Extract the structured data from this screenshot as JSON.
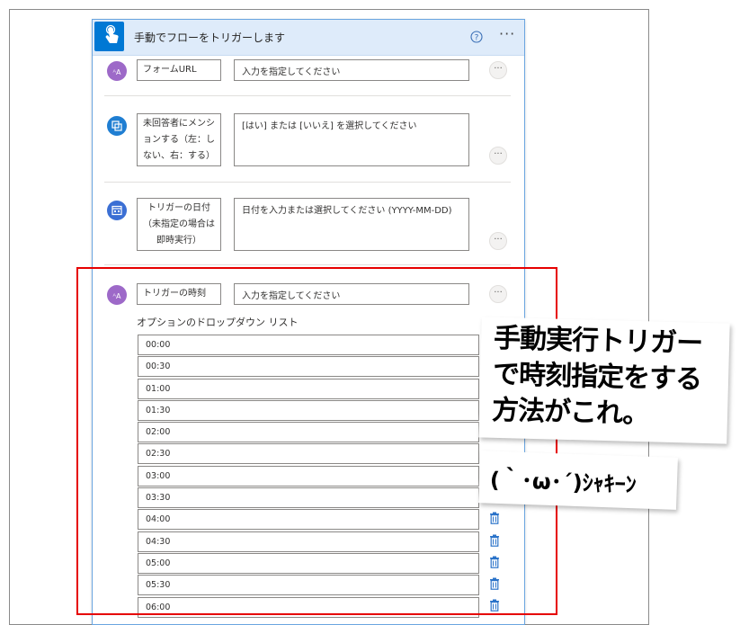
{
  "header": {
    "title": "手動でフローをトリガーします"
  },
  "fields": [
    {
      "label": "フォームURL",
      "placeholder": "入力を指定してください"
    },
    {
      "label": "未回答者にメンションする（左：しない、右：する）",
      "label_lines": [
        "未回答者にメンシ",
        "ョンする（左：し",
        "ない、右：する）"
      ],
      "placeholder": "[はい] または [いいえ] を選択してください"
    },
    {
      "label": "トリガーの日付（未指定の場合は即時実行）",
      "label_lines": [
        "トリガーの日付",
        "（未指定の場合は",
        "即時実行）"
      ],
      "placeholder": "日付を入力または選択してください (YYYY-MM-DD)"
    },
    {
      "label": "トリガーの時刻",
      "placeholder": "入力を指定してください"
    }
  ],
  "dropdown": {
    "caption": "オプションのドロップダウン リスト",
    "options": [
      "00:00",
      "00:30",
      "01:00",
      "01:30",
      "02:00",
      "02:30",
      "03:00",
      "03:30",
      "04:00",
      "04:30",
      "05:00",
      "05:30",
      "06:00"
    ]
  },
  "annotation": {
    "lines": [
      "手動実行トリガー",
      "で時刻指定をする",
      "方法がこれ。"
    ],
    "kaomoji": "(｀･ω･´)ｼｬｷｰﾝ"
  },
  "colors": {
    "accent": "#0078d4",
    "highlight": "#e60000",
    "text_icon": "#9d69c8"
  }
}
